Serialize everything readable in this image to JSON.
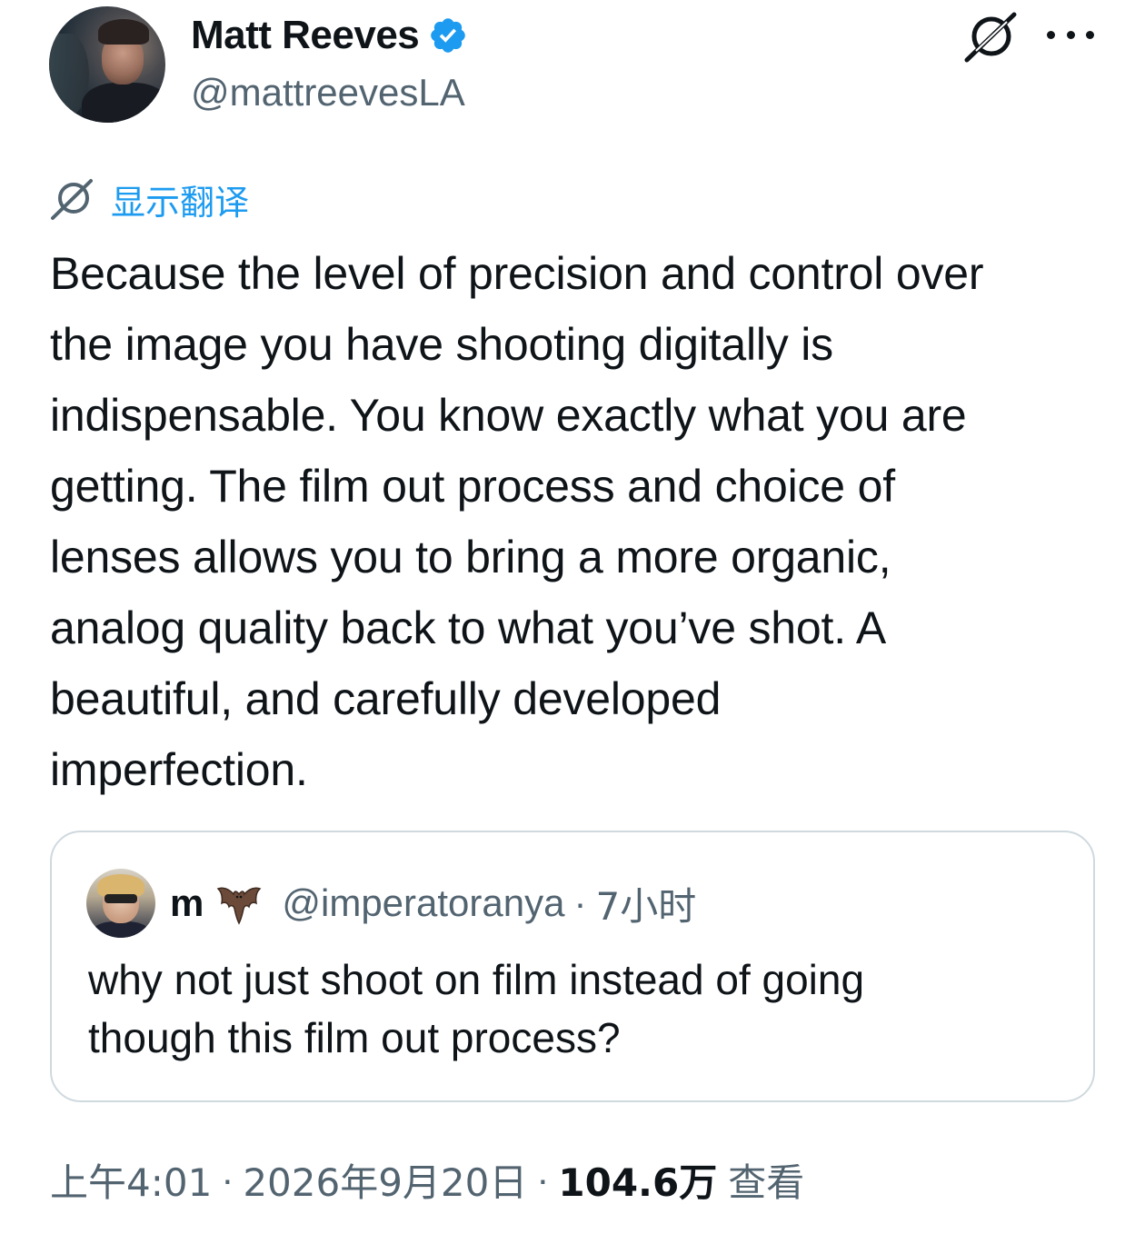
{
  "author": {
    "display_name": "Matt Reeves",
    "handle": "@mattreevesLA",
    "verified": true,
    "verified_color": "#1d9bf0"
  },
  "header": {
    "grok_icon": "grok-icon",
    "more_icon": "more-horizontal-icon"
  },
  "translate": {
    "label": "显示翻译",
    "icon": "grok-icon",
    "color": "#1d9bf0"
  },
  "tweet": {
    "text": "Because the level of precision and control over\nthe image you have shooting digitally is\nindispensable. You know exactly what you are\ngetting. The film out process and choice of\nlenses allows you to bring a more organic,\nanalog quality back to what you’ve shot. A\nbeautiful, and carefully developed\nimperfection."
  },
  "quote": {
    "name": "m",
    "emoji": "bat-emoji",
    "handle": "@imperatoranya",
    "separator": "·",
    "time": "7小时",
    "text": "why not just shoot on film instead of going\nthough this film out process?"
  },
  "meta": {
    "time": "上午4:01",
    "separator": "·",
    "date": "2026年9月20日",
    "views_count": "104.6万",
    "views_label": "查看"
  }
}
